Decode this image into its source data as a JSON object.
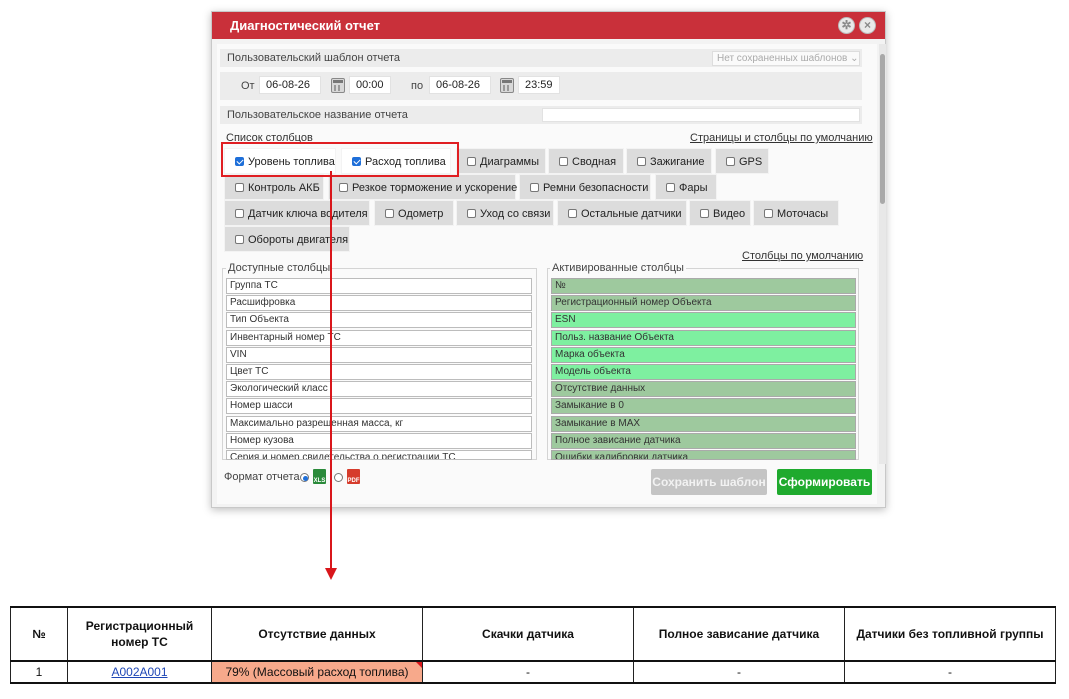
{
  "dialog": {
    "title": "Диагностический отчет",
    "template_label": "Пользовательский шаблон отчета",
    "template_select": "Нет сохраненных шаблонов",
    "from_label": "От",
    "from_date": "06-08-26",
    "from_time": "00:00",
    "to_label": "по",
    "to_date": "06-08-26",
    "to_time": "23:59",
    "custom_name_label": "Пользовательское название отчета",
    "custom_name_value": "",
    "columns_list_link": "Список столбцов",
    "default_pages_link": "Страницы и столбцы по умолчанию",
    "default_columns_link": "Столбцы по умолчанию",
    "available_title": "Доступные столбцы",
    "activated_title": "Активированные столбцы",
    "format_label": "Формат отчета",
    "xls_label": "XLS",
    "pdf_label": "PDF",
    "save_template_btn": "Сохранить шаблон",
    "generate_btn": "Сформировать"
  },
  "tabs": [
    {
      "label": "Уровень топлива",
      "checked": true
    },
    {
      "label": "Расход топлива",
      "checked": true
    },
    {
      "label": "Диаграммы",
      "checked": false
    },
    {
      "label": "Сводная",
      "checked": false
    },
    {
      "label": "Зажигание",
      "checked": false
    },
    {
      "label": "GPS",
      "checked": false
    },
    {
      "label": "Контроль АКБ",
      "checked": false
    },
    {
      "label": "Резкое торможение и ускорение",
      "checked": false
    },
    {
      "label": "Ремни безопасности",
      "checked": false
    },
    {
      "label": "Фары",
      "checked": false
    },
    {
      "label": "Датчик ключа водителя",
      "checked": false
    },
    {
      "label": "Одометр",
      "checked": false
    },
    {
      "label": "Уход со связи",
      "checked": false
    },
    {
      "label": "Остальные датчики",
      "checked": false
    },
    {
      "label": "Видео",
      "checked": false
    },
    {
      "label": "Моточасы",
      "checked": false
    },
    {
      "label": "Обороты двигателя",
      "checked": false
    }
  ],
  "available_columns": [
    "Группа ТС",
    "Расшифровка",
    "Тип Объекта",
    "Инвентарный номер ТС",
    "VIN",
    "Цвет ТС",
    "Экологический класс",
    "Номер шасси",
    "Максимально разрешенная масса, кг",
    "Номер кузова",
    "Серия и номер свидетельства о регистрации ТС"
  ],
  "activated_columns": [
    {
      "label": "№",
      "color": "#9ec99e"
    },
    {
      "label": "Регистрационный номер Объекта",
      "color": "#9ec99e"
    },
    {
      "label": "ESN",
      "color": "#7ef0a0"
    },
    {
      "label": "Польз. название Объекта",
      "color": "#7ef0a0"
    },
    {
      "label": "Марка объекта",
      "color": "#7ef0a0"
    },
    {
      "label": "Модель объекта",
      "color": "#7ef0a0"
    },
    {
      "label": "Отсутствие данных",
      "color": "#9ec99e"
    },
    {
      "label": "Замыкание в 0",
      "color": "#9ec99e"
    },
    {
      "label": "Замыкание в MAX",
      "color": "#9ec99e"
    },
    {
      "label": "Полное зависание датчика",
      "color": "#9ec99e"
    },
    {
      "label": "Ошибки калибровки датчика",
      "color": "#9ec99e"
    }
  ],
  "colors": {
    "title_bar": "#c9303a",
    "generate_btn": "#1faa2e",
    "save_btn_disabled": "#c4c4c4",
    "highlight": "#e01e22",
    "warn_cell": "#f7a98b"
  },
  "result_table": {
    "headers": [
      "№",
      "Регистрационный номер ТС",
      "Отсутствие данных",
      "Скачки датчика",
      "Полное зависание датчика",
      "Датчики без топливной группы"
    ],
    "row": [
      "1",
      "А002А001",
      "79% (Массовый расход топлива)",
      "-",
      "-",
      "-"
    ]
  }
}
